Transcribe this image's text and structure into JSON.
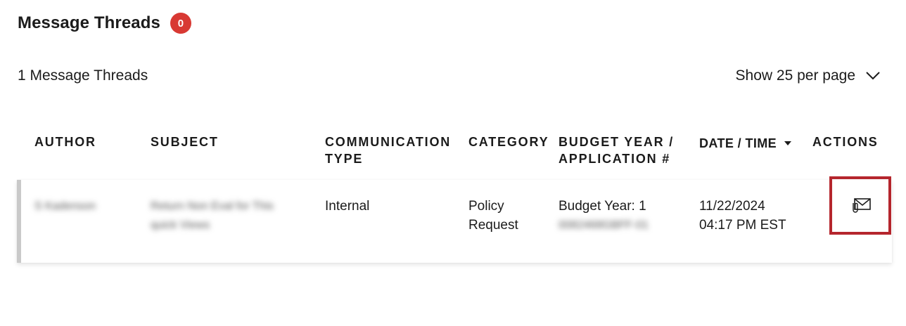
{
  "header": {
    "title": "Message Threads",
    "badge_count": "0"
  },
  "summary": {
    "count_text": "1 Message Threads",
    "per_page_label": "Show 25 per page"
  },
  "table": {
    "columns": {
      "author": "AUTHOR",
      "subject": "SUBJECT",
      "comm_type_line1": "COMMUNICATION",
      "comm_type_line2": "TYPE",
      "category": "CATEGORY",
      "budget_line1": "BUDGET YEAR /",
      "budget_line2": "APPLICATION #",
      "datetime": "DATE / TIME",
      "actions": "ACTIONS"
    },
    "rows": [
      {
        "author": "S Kadenson",
        "subject_line1": "Return Non Eval for This",
        "subject_line2": "quick Views",
        "communication_type": "Internal",
        "category_line1": "Policy",
        "category_line2": "Request",
        "budget_year": "Budget Year: 1",
        "application_number": "0082468GBFF-01",
        "date": "11/22/2024",
        "time": "04:17 PM EST"
      }
    ]
  },
  "colors": {
    "badge": "#d83933",
    "action_highlight": "#b5262d",
    "row_accent": "#c9c9c9"
  },
  "icons": {
    "sort": "caret-down-icon",
    "per_page": "chevron-down-icon",
    "action": "envelope-attachment-icon"
  }
}
